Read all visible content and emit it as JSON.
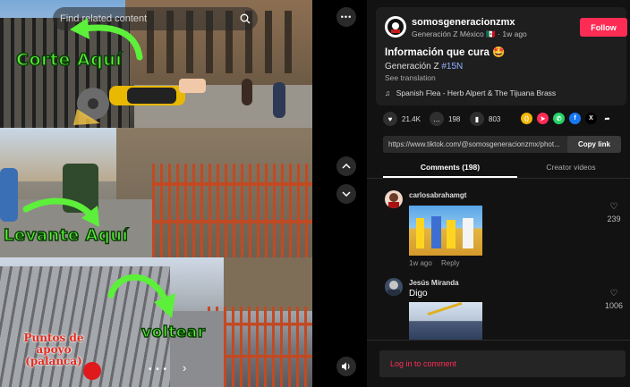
{
  "search": {
    "placeholder": "Find related content"
  },
  "captions": {
    "cut": "Corte Aquí",
    "lift": "Levante Aquí",
    "flip": "voltear",
    "support": [
      "Puntos de",
      "apoyo",
      "(palanca)"
    ]
  },
  "post": {
    "username": "somosgeneracionzmx",
    "display_name": "Generación Z México",
    "flag": "🇲🇽",
    "separator": "·",
    "time": "1w ago",
    "follow_label": "Follow",
    "title": "Información que cura",
    "title_emoji": "🤩",
    "subtitle_prefix": "Generación Z ",
    "hashtag": "#15N",
    "see_translation": "See translation",
    "music_icon": "♫",
    "music": "Spanish Flea - Herb Alpert & The Tijuana Brass"
  },
  "stats": {
    "likes": "21.4K",
    "comments": "198",
    "saves": "803"
  },
  "share_icons": [
    {
      "name": "embed-icon",
      "color": "#f2b707",
      "glyph": "⟨⟩"
    },
    {
      "name": "send-icon",
      "color": "#fe2c55",
      "glyph": "➤"
    },
    {
      "name": "whatsapp-icon",
      "color": "#25d366",
      "glyph": "✆"
    },
    {
      "name": "facebook-icon",
      "color": "#1877f2",
      "glyph": "f"
    },
    {
      "name": "x-icon",
      "color": "#000000",
      "glyph": "X"
    },
    {
      "name": "share-arrow-icon",
      "color": "#121212",
      "glyph": "➦"
    }
  ],
  "link": {
    "url": "https://www.tiktok.com/@somosgeneracionzmx/phot...",
    "copy_label": "Copy link"
  },
  "tabs": {
    "comments": "Comments (198)",
    "creator": "Creator videos"
  },
  "comments": [
    {
      "user": "carlosabrahamgt",
      "text": "",
      "time": "1w ago",
      "reply": "Reply",
      "likes": "239"
    },
    {
      "user": "Jesús Miranda",
      "text": "Digo",
      "likes": "1006"
    }
  ],
  "login": {
    "label": "Log in to comment"
  },
  "colors": {
    "accent": "#fe2c55",
    "caption_green": "#5cf03a",
    "caption_red": "#e52a1f"
  }
}
